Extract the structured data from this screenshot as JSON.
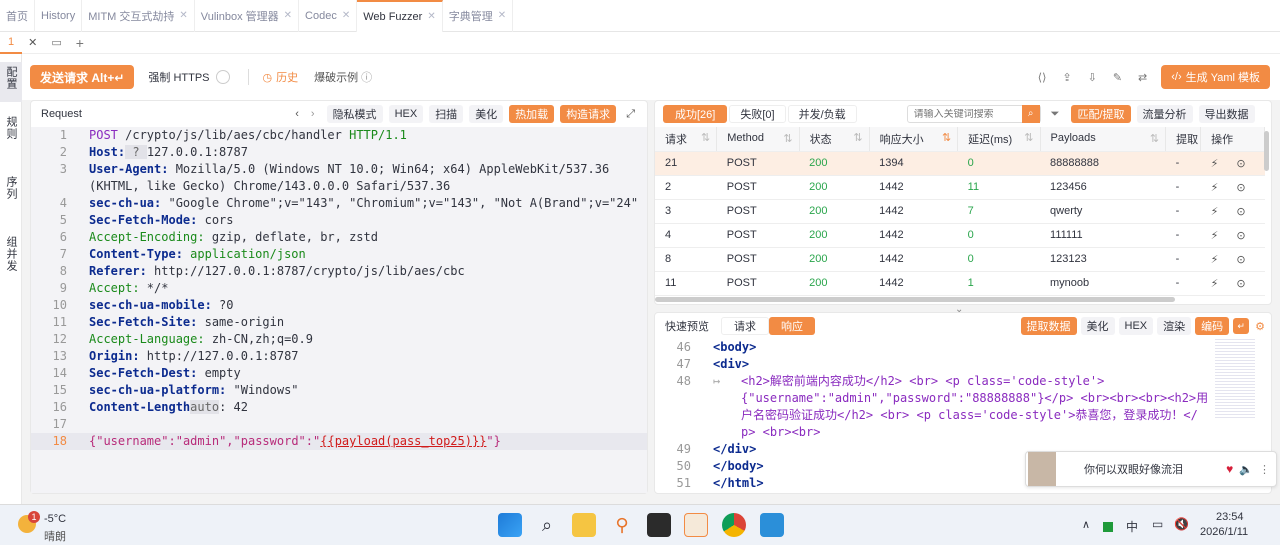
{
  "tabs": [
    {
      "label": "首页"
    },
    {
      "label": "History"
    },
    {
      "label": "MITM 交互式劫持"
    },
    {
      "label": "Vulinbox 管理器"
    },
    {
      "label": "Codec"
    },
    {
      "label": "Web Fuzzer"
    },
    {
      "label": "字典管理"
    }
  ],
  "subtab": {
    "num": "1"
  },
  "sidebar": [
    "配置",
    "规则",
    "序列",
    "组并发"
  ],
  "toolbar": {
    "send": "发送请求 Alt+↵",
    "force_https": "强制 HTTPS",
    "history": "历史",
    "blast_example": "爆破示例",
    "gen_yaml": "生成 Yaml 模板"
  },
  "request": {
    "title": "Request",
    "buttons": [
      "隐私模式",
      "HEX",
      "扫描",
      "美化",
      "热加载",
      "构造请求"
    ],
    "lines": [
      {
        "n": "1",
        "parts": [
          [
            "POST",
            "kw"
          ],
          [
            " /crypto/js/lib/aes/cbc/handler ",
            ""
          ],
          [
            "HTTP/1.1",
            "grn"
          ]
        ]
      },
      {
        "n": "2",
        "parts": [
          [
            "Host:",
            "hk"
          ],
          [
            " ? ",
            "hv"
          ],
          [
            "127.0.0.1:8787",
            ""
          ]
        ]
      },
      {
        "n": "3",
        "parts": [
          [
            "User-Agent:",
            "hk"
          ],
          [
            " Mozilla/5.0 (Windows NT 10.0; Win64; x64) AppleWebKit/537.36",
            ""
          ]
        ]
      },
      {
        "n": "",
        "parts": [
          [
            "(KHTML, like Gecko) Chrome/143.0.0.0 Safari/537.36",
            ""
          ]
        ]
      },
      {
        "n": "4",
        "parts": [
          [
            "sec-ch-ua:",
            "hk"
          ],
          [
            " \"Google Chrome\";v=\"143\", \"Chromium\";v=\"143\", \"Not A(Brand\";v=\"24\"",
            ""
          ]
        ]
      },
      {
        "n": "5",
        "parts": [
          [
            "Sec-Fetch-Mode:",
            "hk"
          ],
          [
            " cors",
            ""
          ]
        ]
      },
      {
        "n": "6",
        "parts": [
          [
            "Accept-Encoding:",
            "grn"
          ],
          [
            " gzip, deflate, br, zstd",
            ""
          ]
        ]
      },
      {
        "n": "7",
        "parts": [
          [
            "Content-Type:",
            "hk"
          ],
          [
            " application/json",
            "grn"
          ]
        ]
      },
      {
        "n": "8",
        "parts": [
          [
            "Referer:",
            "hk"
          ],
          [
            " http://127.0.0.1:8787/crypto/js/lib/aes/cbc",
            ""
          ]
        ]
      },
      {
        "n": "9",
        "parts": [
          [
            "Accept:",
            "grn"
          ],
          [
            " */*",
            ""
          ]
        ]
      },
      {
        "n": "10",
        "parts": [
          [
            "sec-ch-ua-mobile:",
            "hk"
          ],
          [
            " ?0",
            ""
          ]
        ]
      },
      {
        "n": "11",
        "parts": [
          [
            "Sec-Fetch-Site:",
            "hk"
          ],
          [
            " same-origin",
            ""
          ]
        ]
      },
      {
        "n": "12",
        "parts": [
          [
            "Accept-Language:",
            "grn"
          ],
          [
            " zh-CN,zh;q=0.9",
            ""
          ]
        ]
      },
      {
        "n": "13",
        "parts": [
          [
            "Origin:",
            "hk"
          ],
          [
            " http://127.0.0.1:8787",
            ""
          ]
        ]
      },
      {
        "n": "14",
        "parts": [
          [
            "Sec-Fetch-Dest:",
            "hk"
          ],
          [
            " empty",
            ""
          ]
        ]
      },
      {
        "n": "15",
        "parts": [
          [
            "sec-ch-ua-platform:",
            "hk"
          ],
          [
            " \"Windows\"",
            ""
          ]
        ]
      },
      {
        "n": "16",
        "parts": [
          [
            "Content-Length",
            "hk"
          ],
          [
            "auto",
            "hv"
          ],
          [
            ": 42",
            ""
          ]
        ]
      },
      {
        "n": "17",
        "parts": [
          [
            "",
            ""
          ]
        ]
      },
      {
        "n": "18",
        "parts": [
          [
            "{",
            "str"
          ],
          [
            "\"username\"",
            "str"
          ],
          [
            ":",
            "str"
          ],
          [
            "\"admin\"",
            "str"
          ],
          [
            ",",
            "str"
          ],
          [
            "\"password\"",
            "str"
          ],
          [
            ":",
            "str"
          ],
          [
            "\"",
            "str"
          ],
          [
            "{{payload(pass_top25)}}",
            "pl"
          ],
          [
            "\"}",
            "str"
          ]
        ]
      }
    ]
  },
  "results": {
    "tabs": [
      "成功[26]",
      "失败[0]",
      "并发/负载"
    ],
    "search_placeholder": "请输入关键词搜索",
    "buttons": [
      "匹配/提取",
      "流量分析",
      "导出数据"
    ],
    "columns": [
      "请求",
      "Method",
      "状态",
      "响应大小",
      "延迟(ms)",
      "Payloads",
      "提取",
      "操作"
    ],
    "rows": [
      [
        "21",
        "POST",
        "200",
        "1394",
        "0",
        "88888888",
        "-"
      ],
      [
        "2",
        "POST",
        "200",
        "1442",
        "11",
        "123456",
        "-"
      ],
      [
        "3",
        "POST",
        "200",
        "1442",
        "7",
        "qwerty",
        "-"
      ],
      [
        "4",
        "POST",
        "200",
        "1442",
        "0",
        "111111",
        "-"
      ],
      [
        "8",
        "POST",
        "200",
        "1442",
        "0",
        "123123",
        "-"
      ],
      [
        "11",
        "POST",
        "200",
        "1442",
        "1",
        "mynoob",
        "-"
      ]
    ]
  },
  "preview": {
    "label": "快速预览",
    "tabs": [
      "请求",
      "响应"
    ],
    "buttons": [
      "提取数据",
      "美化",
      "HEX",
      "渲染",
      "编码"
    ],
    "lines": [
      {
        "n": "46",
        "text": "<body>"
      },
      {
        "n": "47",
        "text": "<div>"
      },
      {
        "n": "48",
        "text": "<h2>解密前端内容成功</h2> <br> <p class='code-style'>"
      },
      {
        "n": "",
        "text": "{\"username\":\"admin\",\"password\":\"88888888\"}</p> <br><br><br><h2>用"
      },
      {
        "n": "",
        "text": "户名密码验证成功</h2> <br> <p class='code-style'>恭喜您，登录成功！</"
      },
      {
        "n": "",
        "text": "p> <br><br>"
      },
      {
        "n": "49",
        "text": "</div>"
      },
      {
        "n": "50",
        "text": "</body>"
      },
      {
        "n": "51",
        "text": "</html>"
      }
    ]
  },
  "music": {
    "title": "你何以双眼好像流泪"
  },
  "taskbar": {
    "weather_temp": "-5°C",
    "weather_desc": "晴朗",
    "weather_badge": "1",
    "ime": "中",
    "time": "23:54",
    "date": "2026/1/11"
  }
}
